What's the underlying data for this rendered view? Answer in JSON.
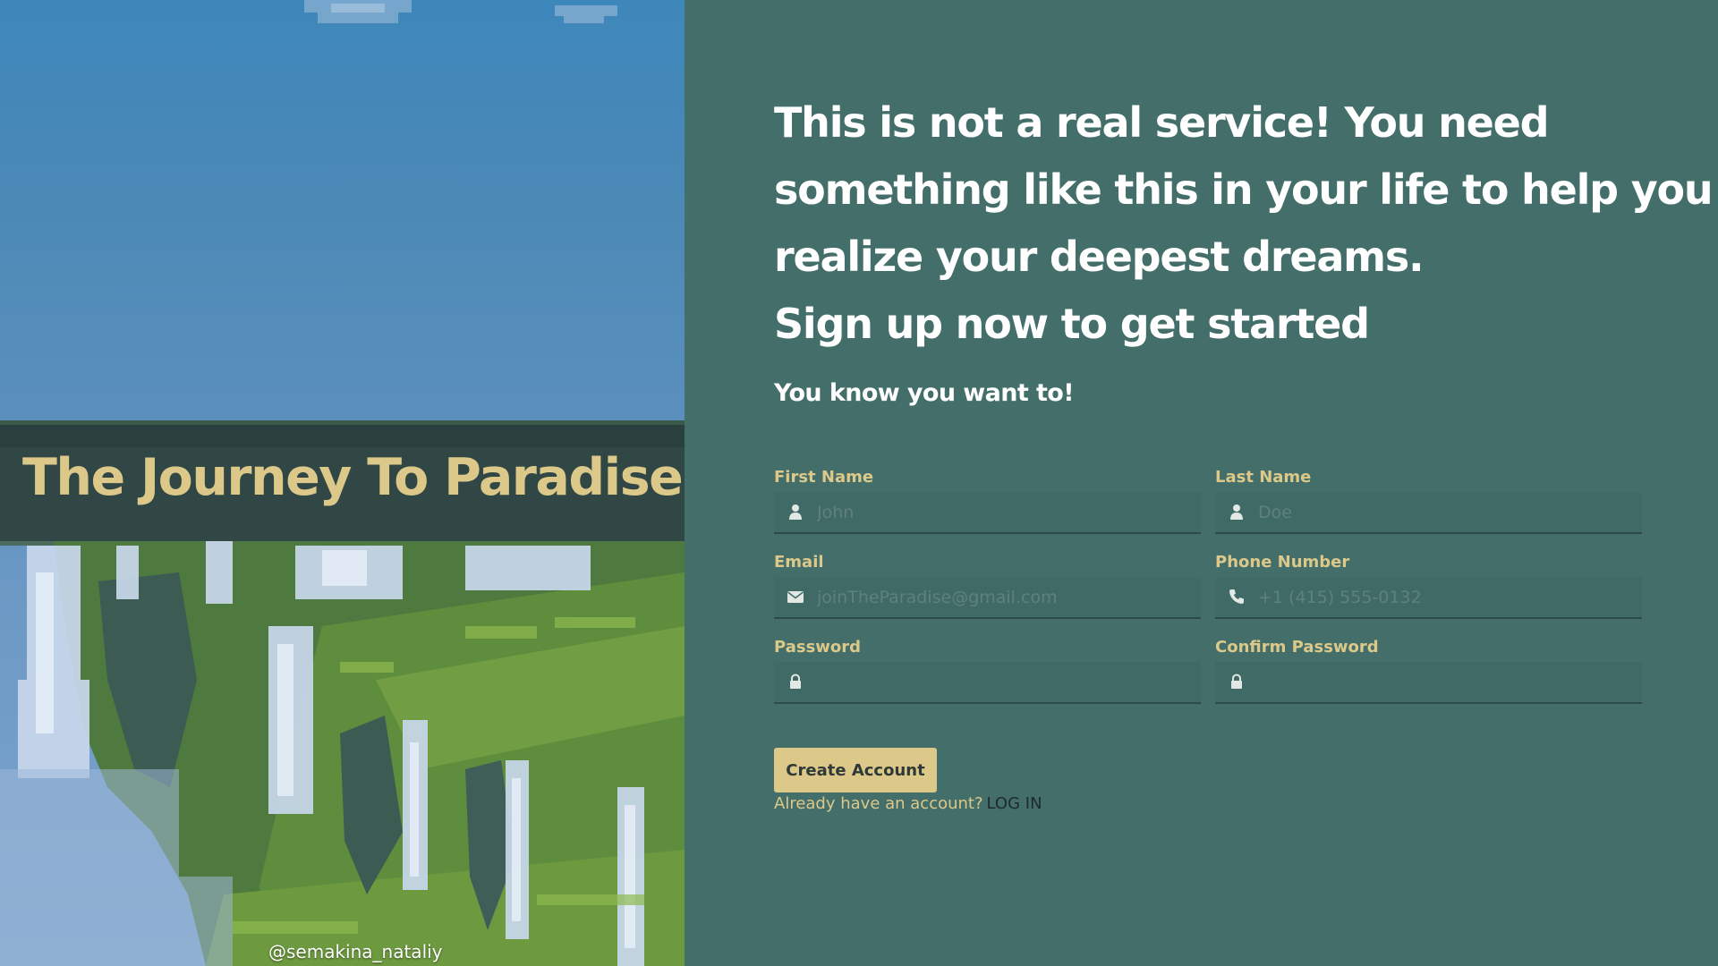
{
  "hero": {
    "title": "The Journey To Paradise",
    "credit": "@semakina_nataliy"
  },
  "main": {
    "headline_lines": [
      "This is not a real service! You need",
      "something like this in your life to help you",
      "realize your deepest dreams.",
      "Sign up now to get started"
    ],
    "subhead": "You know you want to!"
  },
  "form": {
    "first_name": {
      "label": "First Name",
      "placeholder": "John",
      "value": "",
      "icon": "user-icon"
    },
    "last_name": {
      "label": "Last Name",
      "placeholder": "Doe",
      "value": "",
      "icon": "user-icon"
    },
    "email": {
      "label": "Email",
      "placeholder": "joinTheParadise@gmail.com",
      "value": "",
      "icon": "envelope-icon"
    },
    "phone": {
      "label": "Phone Number",
      "placeholder": "+1 (415) 555-0132",
      "value": "",
      "icon": "phone-icon"
    },
    "password": {
      "label": "Password",
      "placeholder": "",
      "value": "",
      "icon": "lock-icon"
    },
    "confirm_password": {
      "label": "Confirm Password",
      "placeholder": "",
      "value": "",
      "icon": "lock-icon"
    },
    "submit_label": "Create Account",
    "login_prompt": "Already have an account?",
    "login_link": "LOG IN"
  },
  "colors": {
    "background": "#436e6a",
    "accent": "#dcc98a",
    "headline": "#ffffff",
    "input_border": "#2d4b48",
    "link": "#1f2a29"
  }
}
